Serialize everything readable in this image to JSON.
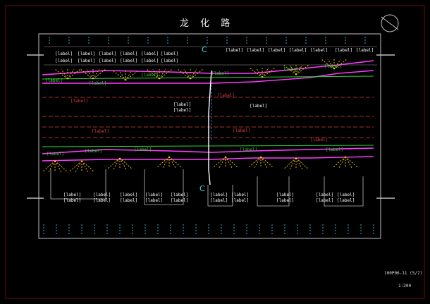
{
  "drawing": {
    "title": "龙 化 路",
    "drawing_number": "100P06-11 (5/7)",
    "scale": "1:200"
  },
  "colors": {
    "background": "#000000",
    "frame": "#c0c0c0",
    "road_line": "#ff3cff",
    "dash_line": "#e63b3b",
    "green_line": "#2fd12f",
    "label": "#ffffff",
    "yellow": "#ffd200",
    "cyan": "#34e3f0",
    "orange": "#ff7a1a",
    "blue": "#3f86ff"
  },
  "icons": {
    "north_arrow": "north-arrow-icon",
    "section_marker": "section-marker-icon"
  },
  "placeholder_label": "[label]"
}
